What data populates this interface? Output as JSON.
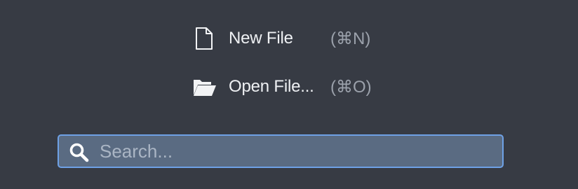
{
  "actions": {
    "new_file": {
      "label": "New File",
      "shortcut": "(⌘N)",
      "icon": "document-icon"
    },
    "open_file": {
      "label": "Open File...",
      "shortcut": "(⌘O)",
      "icon": "folder-open-icon"
    }
  },
  "search": {
    "placeholder": "Search...",
    "value": "",
    "icon": "search-icon"
  },
  "colors": {
    "background": "#373b44",
    "search_fill": "#5a6b82",
    "search_border": "#6ea1e6",
    "label_text": "#eef0f3",
    "shortcut_text": "#9ba1ab"
  }
}
